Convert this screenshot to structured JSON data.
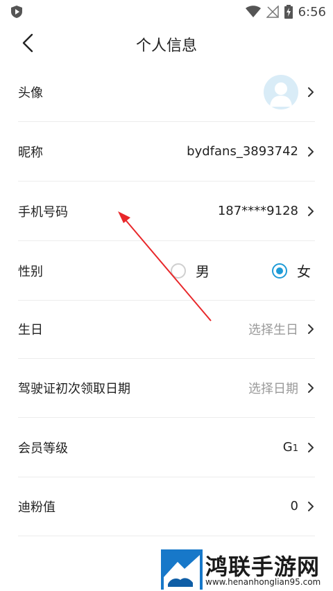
{
  "status_bar": {
    "time": "6:56"
  },
  "header": {
    "title": "个人信息"
  },
  "rows": {
    "avatar": {
      "label": "头像"
    },
    "nickname": {
      "label": "昵称",
      "value": "bydfans_3893742"
    },
    "phone": {
      "label": "手机号码",
      "value": "187****9128"
    },
    "gender": {
      "label": "性别",
      "male": "男",
      "female": "女",
      "selected": "女"
    },
    "birthday": {
      "label": "生日",
      "placeholder": "选择生日"
    },
    "license_date": {
      "label": "驾驶证初次领取日期",
      "placeholder": "选择日期"
    },
    "member_level": {
      "label": "会员等级",
      "value_main": "G",
      "value_sub": "1"
    },
    "points": {
      "label": "迪粉值",
      "value": "0"
    }
  },
  "watermark": {
    "text": "鸿联手游网",
    "url": "www.henanhonglian95.com"
  },
  "colors": {
    "accent": "#1e9bd7",
    "annotation_arrow": "#e8272a",
    "avatar_bg": "#d9ecf7"
  }
}
